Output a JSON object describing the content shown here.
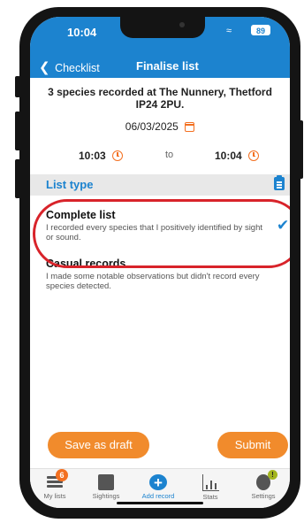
{
  "status_bar": {
    "time": "10:04",
    "battery": "89"
  },
  "header": {
    "back_label": "Checklist",
    "title": "Finalise list"
  },
  "summary": {
    "text": "3 species recorded at The Nunnery, Thetford IP24 2PU.",
    "date": "06/03/2025"
  },
  "times": {
    "start": "10:03",
    "separator": "to",
    "end": "10:04"
  },
  "list_type": {
    "title": "List type",
    "options": [
      {
        "title": "Complete list",
        "description": "I recorded every species that I positively identified by sight or sound.",
        "selected": true
      },
      {
        "title": "Casual records",
        "description": "I made some notable observations but didn't record every species detected.",
        "selected": false
      }
    ]
  },
  "actions": {
    "draft": "Save as draft",
    "submit": "Submit"
  },
  "tabs": [
    {
      "label": "My lists",
      "badge": "6",
      "icon": "list-icon"
    },
    {
      "label": "Sightings",
      "icon": "map-icon"
    },
    {
      "label": "Add record",
      "icon": "plus-icon",
      "active": true
    },
    {
      "label": "Stats",
      "icon": "stats-icon"
    },
    {
      "label": "Settings",
      "badge": "!",
      "icon": "gear-icon"
    }
  ],
  "colors": {
    "brand_blue": "#1c83cf",
    "accent_orange": "#f18b2c",
    "highlight_red": "#d8232a"
  }
}
